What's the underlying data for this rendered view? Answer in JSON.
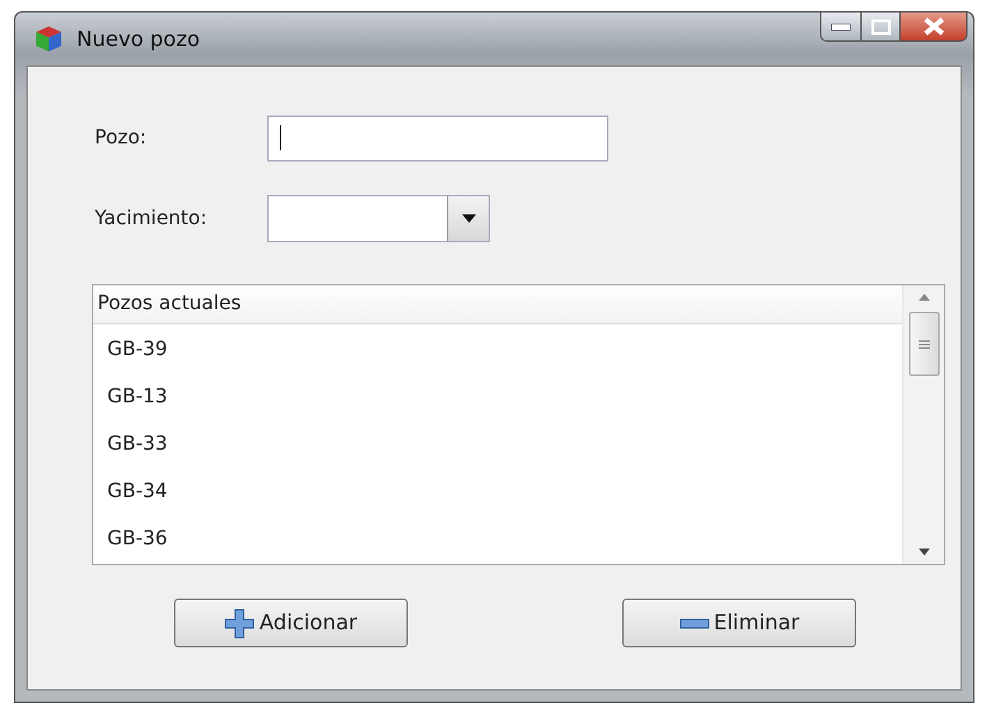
{
  "window": {
    "title": "Nuevo pozo"
  },
  "fields": [
    {
      "label": "Pozo:",
      "kind": "text",
      "focused": true
    },
    {
      "label": "Yacimiento:",
      "kind": "combo"
    }
  ],
  "list": {
    "header": "Pozos actuales",
    "items": [
      "GB-39",
      "GB-13",
      "GB-33",
      "GB-34",
      "GB-36"
    ]
  },
  "buttons": [
    {
      "label": "Adicionar",
      "kind": "add"
    },
    {
      "label": "Eliminar",
      "kind": "remove"
    }
  ]
}
